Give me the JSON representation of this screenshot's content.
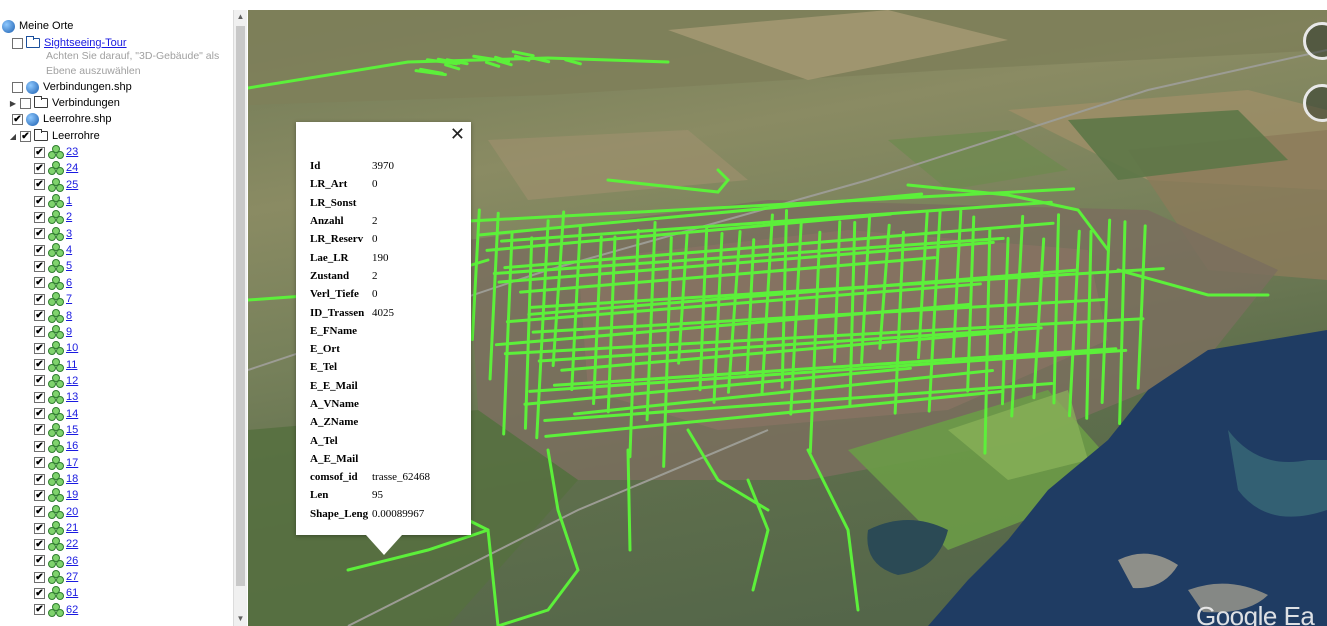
{
  "tree": {
    "root_label": "Meine Orte",
    "sightseeing_label": "Sightseeing-Tour",
    "note_line1": "Achten Sie darauf, \"3D-Gebäude\" als",
    "note_line2": "Ebene auszuwählen",
    "verbindungen_shp": "Verbindungen.shp",
    "verbindungen_folder": "Verbindungen",
    "leerrohre_shp": "Leerrohre.shp",
    "leerrohre_folder": "Leerrohre",
    "items": [
      "23",
      "24",
      "25",
      "1",
      "2",
      "3",
      "4",
      "5",
      "6",
      "7",
      "8",
      "9",
      "10",
      "11",
      "12",
      "13",
      "14",
      "15",
      "16",
      "17",
      "18",
      "19",
      "20",
      "21",
      "22",
      "26",
      "27",
      "61",
      "62"
    ]
  },
  "balloon": {
    "close_glyph": "✕",
    "rows": [
      {
        "k": "Id",
        "v": "3970"
      },
      {
        "k": "LR_Art",
        "v": "0"
      },
      {
        "k": "LR_Sonst",
        "v": ""
      },
      {
        "k": "Anzahl",
        "v": "2"
      },
      {
        "k": "LR_Reserv",
        "v": "0"
      },
      {
        "k": "Lae_LR",
        "v": "190"
      },
      {
        "k": "Zustand",
        "v": "2"
      },
      {
        "k": "Verl_Tiefe",
        "v": "0"
      },
      {
        "k": "ID_Trassen",
        "v": "4025"
      },
      {
        "k": "E_FName",
        "v": ""
      },
      {
        "k": "E_Ort",
        "v": ""
      },
      {
        "k": "E_Tel",
        "v": ""
      },
      {
        "k": "E_E_Mail",
        "v": ""
      },
      {
        "k": "A_VName",
        "v": ""
      },
      {
        "k": "A_ZName",
        "v": ""
      },
      {
        "k": "A_Tel",
        "v": ""
      },
      {
        "k": "A_E_Mail",
        "v": ""
      },
      {
        "k": "comsof_id",
        "v": "trasse_62468"
      },
      {
        "k": "Len",
        "v": "95"
      },
      {
        "k": "Shape_Leng",
        "v": "0.00089967"
      }
    ]
  },
  "map": {
    "watermark": "Google Ea",
    "line_color": "#5cf03a",
    "water_color": "#1f3c63"
  },
  "icons": {
    "check": "✔",
    "expanded": "◢",
    "collapsed": "▶"
  }
}
